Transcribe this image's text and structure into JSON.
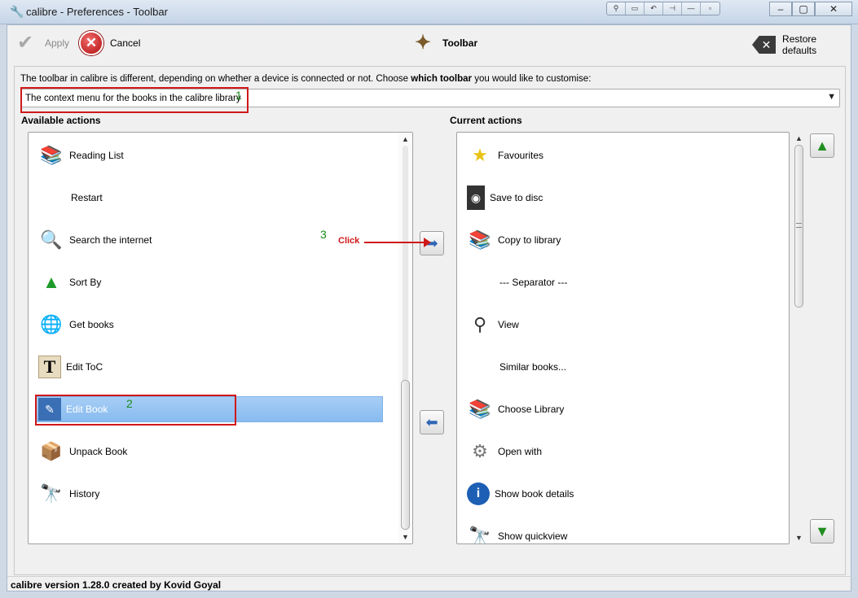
{
  "window": {
    "title": "calibre - Preferences - Toolbar",
    "app_icon": "calibre-icon"
  },
  "toolbar": {
    "apply_label": "Apply",
    "cancel_label": "Cancel",
    "heading": "Toolbar",
    "restore_label": "Restore defaults"
  },
  "choose": {
    "prefix": "The toolbar in calibre is different, depending on whether a device is connected or not. Choose ",
    "bold": "which toolbar",
    "suffix": " you would like to customise:",
    "selected": "The context menu for the books in the calibre library"
  },
  "available": {
    "label": "Available actions",
    "items": [
      {
        "label": "Reading List",
        "icon": "books-icon"
      },
      {
        "label": "Restart",
        "icon": ""
      },
      {
        "label": "Search the internet",
        "icon": "magnifier-globe-icon"
      },
      {
        "label": "Sort By",
        "icon": "green-triangle-icon"
      },
      {
        "label": "Get books",
        "icon": "globe-icon"
      },
      {
        "label": "Edit ToC",
        "icon": "letter-tile-icon"
      },
      {
        "label": "Edit Book",
        "icon": "edit-book-icon",
        "selected": true
      },
      {
        "label": "Unpack Book",
        "icon": "package-icon"
      },
      {
        "label": "History",
        "icon": "binoculars-icon"
      }
    ]
  },
  "current": {
    "label": "Current actions",
    "items": [
      {
        "label": "Favourites",
        "icon": "star-icon"
      },
      {
        "label": "Save to disc",
        "icon": "disc-icon"
      },
      {
        "label": "Copy to library",
        "icon": "library-books-icon"
      },
      {
        "label": "--- Separator ---",
        "icon": ""
      },
      {
        "label": "View",
        "icon": "magnifier-icon"
      },
      {
        "label": "Similar books...",
        "icon": ""
      },
      {
        "label": "Choose Library",
        "icon": "library-books-icon"
      },
      {
        "label": "Open with",
        "icon": "gears-icon"
      },
      {
        "label": "Show book details",
        "icon": "info-icon"
      },
      {
        "label": "Show quickview",
        "icon": "binoculars-icon"
      }
    ]
  },
  "annotations": {
    "n1": "1",
    "n2": "2",
    "n3": "3",
    "click": "Click"
  },
  "status": "calibre version 1.28.0 created by Kovid Goyal"
}
